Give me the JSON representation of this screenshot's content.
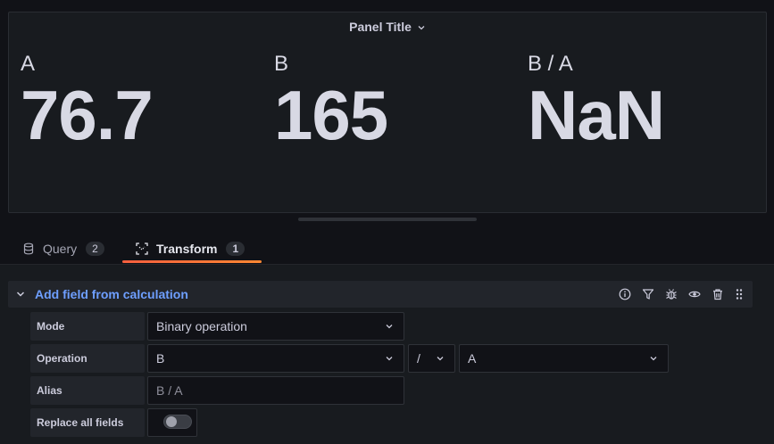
{
  "panel": {
    "title": "Panel Title",
    "stats": [
      {
        "label": "A",
        "value": "76.7"
      },
      {
        "label": "B",
        "value": "165"
      },
      {
        "label": "B / A",
        "value": "NaN"
      }
    ]
  },
  "tabs": [
    {
      "label": "Query",
      "count": "2",
      "icon": "database-icon"
    },
    {
      "label": "Transform",
      "count": "1",
      "icon": "transform-icon",
      "active": true
    }
  ],
  "transformation": {
    "title": "Add field from calculation",
    "actions": [
      "info-icon",
      "filter-icon",
      "debug-icon",
      "eye-icon",
      "trash-icon",
      "drag-handle-icon"
    ],
    "fields": {
      "mode": {
        "label": "Mode",
        "value": "Binary operation"
      },
      "operation": {
        "label": "Operation",
        "left": "B",
        "operator": "/",
        "right": "A"
      },
      "alias": {
        "label": "Alias",
        "placeholder": "B / A",
        "value": ""
      },
      "replace": {
        "label": "Replace all fields",
        "value": false
      }
    }
  },
  "colors": {
    "background": "#111217",
    "panel": "#181b1f",
    "accent_link": "#6e9fff",
    "tab_underline": "#f55f3e"
  }
}
